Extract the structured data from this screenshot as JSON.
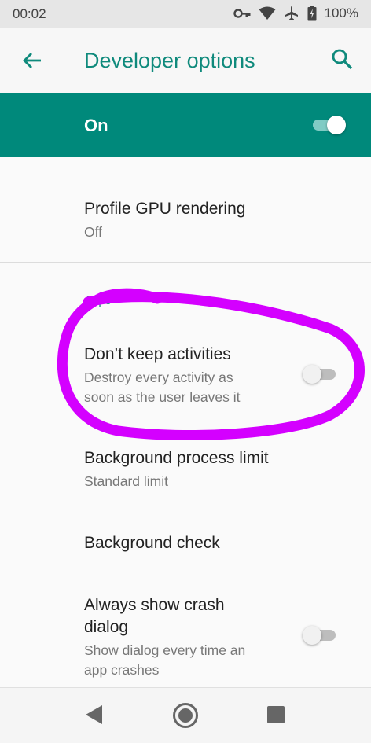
{
  "status": {
    "time": "00:02",
    "battery": "100%"
  },
  "appbar": {
    "title": "Developer options"
  },
  "master": {
    "label": "On",
    "checked": true
  },
  "settings": {
    "profile_gpu": {
      "title": "Profile GPU rendering",
      "summary": "Off"
    },
    "section_header": "Apps",
    "dont_keep": {
      "title": "Don’t keep activities",
      "summary_line1": "Destroy every activity as",
      "summary_line2": "soon as the user leaves it",
      "checked": false
    },
    "bg_limit": {
      "title": "Background process limit",
      "summary": "Standard limit"
    },
    "bg_check": {
      "title": "Background check"
    },
    "crash_dialog": {
      "title_line1": "Always show crash",
      "title_line2": "dialog",
      "summary_line1": "Show dialog every time an",
      "summary_line2": "app crashes",
      "checked": false
    }
  },
  "icons": {
    "back": "arrow-back-icon",
    "search": "search-icon",
    "nav_back": "nav-back-icon",
    "nav_home": "nav-home-icon",
    "nav_recents": "nav-recents-icon"
  },
  "colors": {
    "accent": "#00897b",
    "title": "#0f8a7c",
    "annotation": "#d400ff"
  }
}
